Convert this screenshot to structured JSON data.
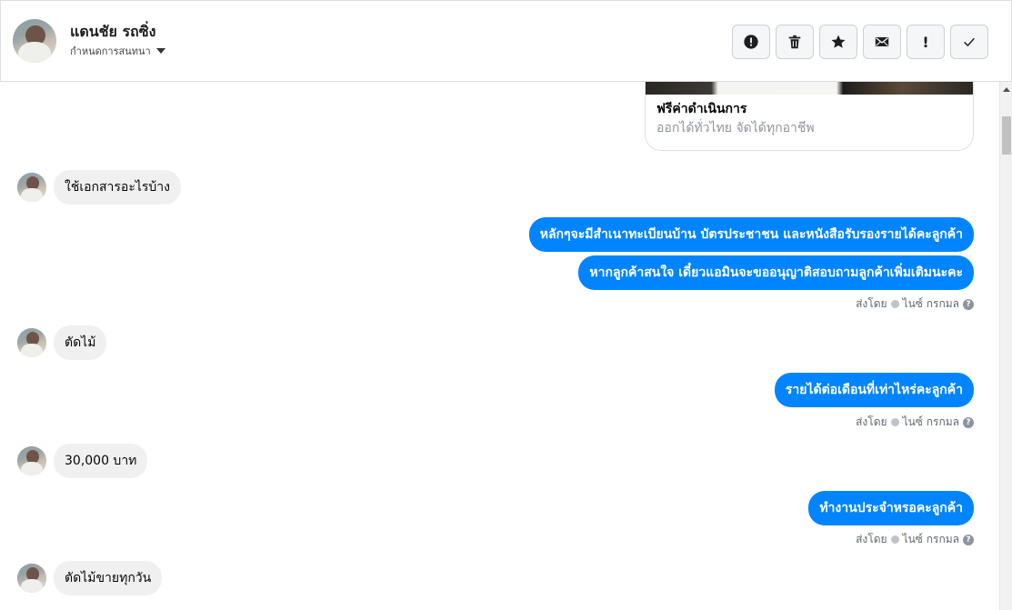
{
  "contact": {
    "name": "แดนชัย รถซิ่ง",
    "assign_label": "กำหนดการสนทนา"
  },
  "toolbar": {
    "spam": "!",
    "check": "✓"
  },
  "link_card": {
    "title": "ฟรีค่าดำเนินการ",
    "description": "ออกได้ทั่วไทย จัดได้ทุกอาชีพ"
  },
  "messages": [
    {
      "side": "in",
      "text": "ใช้เอกสารอะไรบ้าง"
    },
    {
      "side": "out",
      "text": "หลักๆจะมีสำเนาทะเบียนบ้าน บัตรประชาชน และหนังสือรับรองรายได้คะลูกค้า"
    },
    {
      "side": "out",
      "text": "หากลูกค้าสนใจ เดี๋ยวแอมินจะขออนุญาติสอบถามลูกค้าเพิ่มเติมนะคะ"
    },
    {
      "side": "in",
      "text": "ตัดไม้"
    },
    {
      "side": "out",
      "text": "รายได้ต่อเดือนที่เท่าไหร่คะลูกค้า"
    },
    {
      "side": "in",
      "text": "30,000 บาท"
    },
    {
      "side": "out",
      "text": "ทำงานประจำหรอคะลูกค้า"
    },
    {
      "side": "in",
      "text": "ตัดไม้ขายทุกวัน"
    }
  ],
  "sent_by": {
    "prefix": "ส่งโดย",
    "agent": "ไนซ์ กรกมล",
    "help": "?"
  }
}
